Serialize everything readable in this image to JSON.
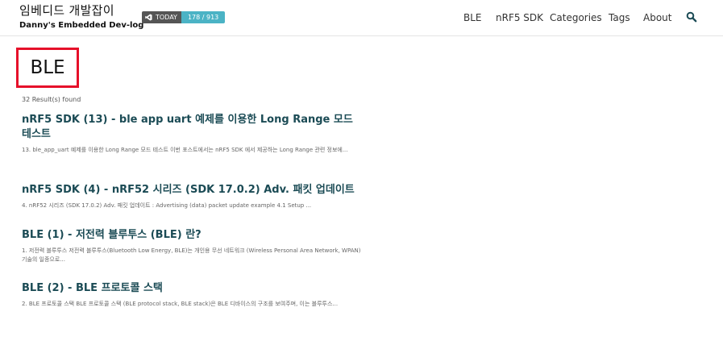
{
  "header": {
    "title": "임베디드 개발잡이",
    "subtitle": "Danny's Embedded Dev-log",
    "badge": {
      "icon": "vscode-icon",
      "label": "TODAY",
      "count": "178 / 913"
    },
    "nav": [
      "BLE",
      "nRF5 SDK",
      "Categories",
      "Tags",
      "About"
    ],
    "search_icon": "search-icon"
  },
  "search": {
    "query": "BLE",
    "highlight_color": "#e6102a",
    "results_text": "32 Result(s) found"
  },
  "colors": {
    "title": "#1b4b55",
    "badge_value": "#4bb3c5"
  },
  "results": [
    {
      "title": "nRF5 SDK (13) - ble app uart 예제를 이용한 Long Range 모드 테스트",
      "excerpt": "13. ble_app_uart 예제를 이용한 Long Range 모드 테스트 이번 포스트에서는 nRF5 SDK 에서 제공하는 Long Range 관련 정보에..."
    },
    {
      "title": "nRF5 SDK (4) - nRF52 시리즈 (SDK 17.0.2) Adv. 패킷 업데이트",
      "excerpt": "4. nRF52 시리즈 (SDK 17.0.2) Adv. 패킷 업데이트 : Advertising (data) packet update example 4.1 Setup ..."
    },
    {
      "title": "BLE (1) - 저전력 블루투스 (BLE) 란?",
      "excerpt": "1. 저전력 블루투스 저전력 블루투스(Bluetooth Low Energy, BLE)는 개인용 무선 네트워크 (Wireless Personal Area Network, WPAN) 기술의 일종으로..."
    },
    {
      "title": "BLE (2) - BLE 프로토콜 스택",
      "excerpt": "2. BLE 프로토콜 스택 BLE 프로토콜 스택 (BLE protocol stack, BLE stack)은 BLE 디바이스의 구조를 보여주며, 이는 블루투스..."
    }
  ]
}
